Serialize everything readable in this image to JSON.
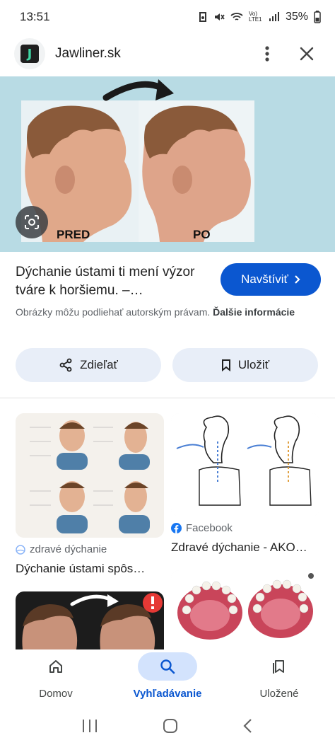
{
  "status_bar": {
    "time": "13:51",
    "network_label": "Vo) LTE1",
    "battery": "35%"
  },
  "header": {
    "logo_letter": "J",
    "site_name": "Jawliner.sk"
  },
  "hero": {
    "label_before": "PRED",
    "label_after": "PO"
  },
  "result": {
    "title": "Dýchanie ústami ti mení výzor tváre k horšiemu. –…",
    "visit_label": "Navštíviť",
    "copyright_text": "Obrázky môžu podliehať autorským právam.",
    "copyright_more": "Ďalšie informácie",
    "share_label": "Zdieľať",
    "save_label": "Uložiť"
  },
  "related": [
    {
      "source": "zdravé dýchanie",
      "title": "Dýchanie ústami spôs…"
    },
    {
      "source": "Facebook",
      "title": "Zdravé dýchanie - AKO…"
    }
  ],
  "bottom_nav": {
    "home_label": "Domov",
    "search_label": "Vyhľadávanie",
    "saved_label": "Uložené"
  },
  "colors": {
    "accent": "#0b57d0",
    "hero_bg": "#b8dbe4",
    "pill_bg": "#e8eef8"
  }
}
